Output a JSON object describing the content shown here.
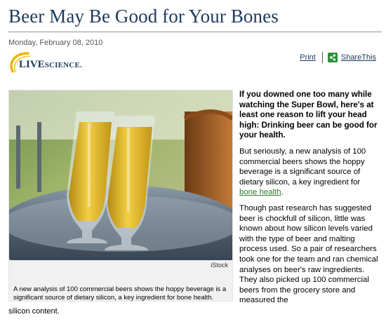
{
  "article": {
    "headline": "Beer May Be Good for Your Bones",
    "date": "Monday, February 08, 2010",
    "lead": "If you downed one too many while watching the Super Bowl, here's at least one reason to lift your head high: Drinking beer can be good for your health.",
    "para2_text": "But seriously, a new analysis of 100 commercial beers shows the hoppy beverage is a significant source of dietary silicon, a key ingredient for ",
    "para2_link": "bone health",
    "para2_end": ".",
    "para3": "Though past research has suggested beer is chockfull of silicon, little was known about how silicon levels varied with the type of beer and malting process used. So a pair of researchers took one for the team and ran chemical analyses on beer's raw ingredients. They also picked up 100 commercial beers from the grocery store and measured the",
    "para3_trail": "silicon content."
  },
  "brand": {
    "name_big": "LIVE",
    "name_small": "SCIENCE."
  },
  "tools": {
    "print_label": "Print",
    "share_label": "ShareThis"
  },
  "photo": {
    "credit": "iStock",
    "caption": "A new analysis of 100 commercial beers shows the hoppy beverage is a significant source of dietary silicon, a key ingredient for bone health."
  },
  "colors": {
    "headline": "#1d3a5c",
    "link_green": "#2f7a2f",
    "brand_yellow": "#f0b400"
  }
}
